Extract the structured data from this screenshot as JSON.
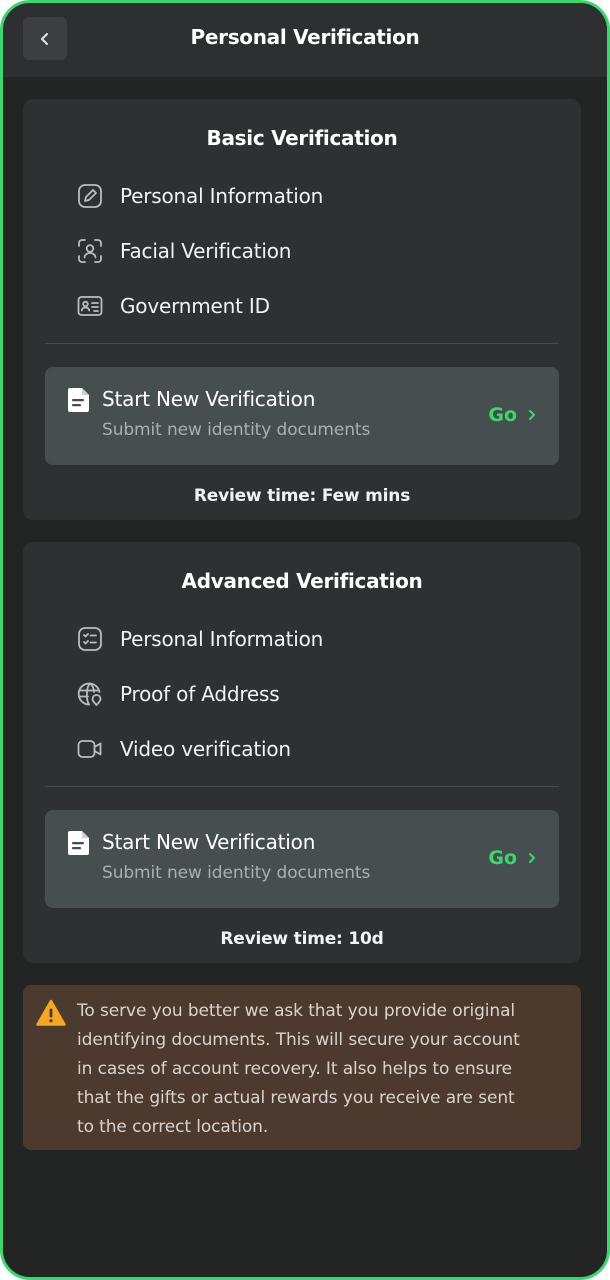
{
  "header": {
    "title": "Personal Verification",
    "back_icon": "chevron-left-icon"
  },
  "basic": {
    "title": "Basic Verification",
    "items": [
      {
        "label": "Personal Information",
        "icon": "edit-pencil-icon"
      },
      {
        "label": "Facial Verification",
        "icon": "face-scan-icon"
      },
      {
        "label": "Government ID",
        "icon": "id-card-icon"
      }
    ],
    "start": {
      "title": "Start New Verification",
      "subtitle": "Submit new identity documents",
      "go_label": "Go",
      "icon": "document-icon"
    },
    "review_time": "Review time: Few mins"
  },
  "advanced": {
    "title": "Advanced Verification",
    "items": [
      {
        "label": "Personal Information",
        "icon": "checklist-icon"
      },
      {
        "label": "Proof of Address",
        "icon": "globe-pin-icon"
      },
      {
        "label": "Video verification",
        "icon": "video-camera-icon"
      }
    ],
    "start": {
      "title": "Start New Verification",
      "subtitle": "Submit new identity documents",
      "go_label": "Go",
      "icon": "document-icon"
    },
    "review_time": "Review time: 10d"
  },
  "notice": {
    "icon": "warning-icon",
    "lines": [
      "To serve you better we ask that you provide original",
      "identifying documents. This will secure your account",
      "in cases of account recovery. It also helps to ensure",
      "that the gifts or actual rewards you receive are sent",
      "to the correct location."
    ]
  },
  "colors": {
    "accent": "#3dd66c",
    "background": "#232424",
    "card": "#2d3132",
    "start_box": "#464e50",
    "notice_bg": "#4d3a2e",
    "warning": "#f5a623"
  }
}
